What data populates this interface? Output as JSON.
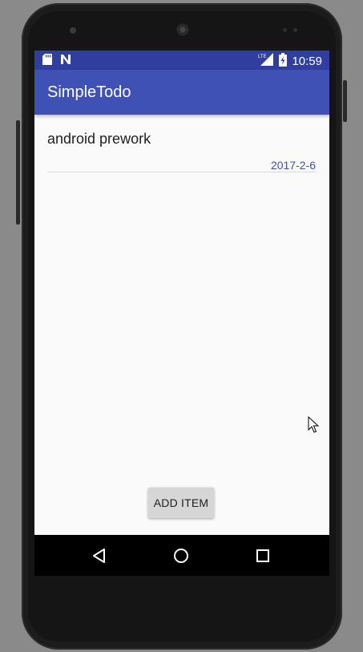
{
  "status_bar": {
    "time": "10:59",
    "icons": [
      "sd-card-icon",
      "n-notification-icon",
      "lte-signal-icon",
      "battery-charging-icon"
    ]
  },
  "app_bar": {
    "title": "SimpleTodo"
  },
  "todo_list": [
    {
      "title": "android prework",
      "date": "2017-2-6"
    }
  ],
  "add_button": {
    "label": "ADD ITEM"
  },
  "nav_bar": {
    "icons": [
      "back-icon",
      "home-icon",
      "recents-icon"
    ]
  },
  "colors": {
    "status_bar": "#303f9f",
    "app_bar": "#3f51b5",
    "accent_date": "#3f51b5",
    "screen_bg": "#fafafa"
  }
}
